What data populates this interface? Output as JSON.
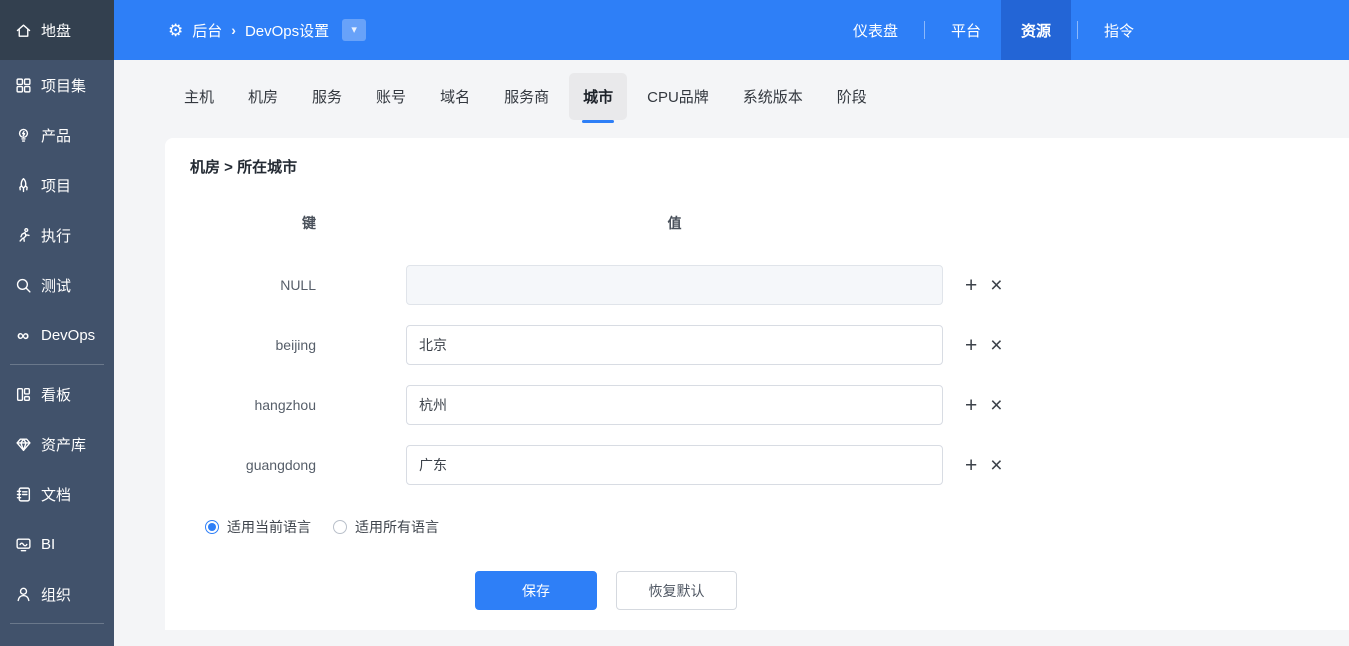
{
  "colors": {
    "accent": "#2e7ff7",
    "topnav_active_bg": "#2365d6",
    "sidebar_bg": "#41526b",
    "sidebar_top_bg": "#33404f",
    "page_bg": "#f4f5f7",
    "active_tab_bg": "#e9e9eb",
    "disabled_input_bg": "#f5f7fa"
  },
  "icons": {
    "gear": "⚙",
    "caret_down": "▾",
    "breadcrumb_sep": "›",
    "plus": "+",
    "close": "×",
    "infinity": "∞"
  },
  "sidebar": {
    "home": {
      "label": "地盘"
    },
    "primary": [
      {
        "icon": "grid-icon",
        "label": "项目集"
      },
      {
        "icon": "bulb-icon",
        "label": "产品"
      },
      {
        "icon": "rocket-icon",
        "label": "项目"
      },
      {
        "icon": "runner-icon",
        "label": "执行"
      },
      {
        "icon": "magnifier-icon",
        "label": "测试"
      },
      {
        "icon": "infinity-icon",
        "label": "DevOps"
      }
    ],
    "secondary": [
      {
        "icon": "kanban-icon",
        "label": "看板"
      },
      {
        "icon": "gem-icon",
        "label": "资产库"
      },
      {
        "icon": "notebook-icon",
        "label": "文档"
      },
      {
        "icon": "monitor-icon",
        "label": "BI"
      },
      {
        "icon": "person-icon",
        "label": "组织"
      }
    ]
  },
  "header": {
    "breadcrumb": {
      "section": "后台",
      "page": "DevOps设置"
    },
    "nav": [
      {
        "label": "仪表盘",
        "active": false
      },
      {
        "label": "平台",
        "active": false
      },
      {
        "label": "资源",
        "active": true
      },
      {
        "label": "指令",
        "active": false
      }
    ]
  },
  "tabs": {
    "labels": [
      "主机",
      "机房",
      "服务",
      "账号",
      "域名",
      "服务商",
      "城市",
      "CPU品牌",
      "系统版本",
      "阶段"
    ],
    "active": "城市"
  },
  "content": {
    "title": "机房 > 所在城市",
    "table": {
      "key_header": "键",
      "value_header": "值",
      "rows": [
        {
          "key": "NULL",
          "value": "",
          "disabled": true
        },
        {
          "key": "beijing",
          "value": "北京",
          "disabled": false
        },
        {
          "key": "hangzhou",
          "value": "杭州",
          "disabled": false
        },
        {
          "key": "guangdong",
          "value": "广东",
          "disabled": false
        }
      ]
    },
    "language_options": [
      {
        "label": "适用当前语言",
        "selected": true
      },
      {
        "label": "适用所有语言",
        "selected": false
      }
    ],
    "actions": {
      "save": "保存",
      "restore": "恢复默认"
    }
  }
}
